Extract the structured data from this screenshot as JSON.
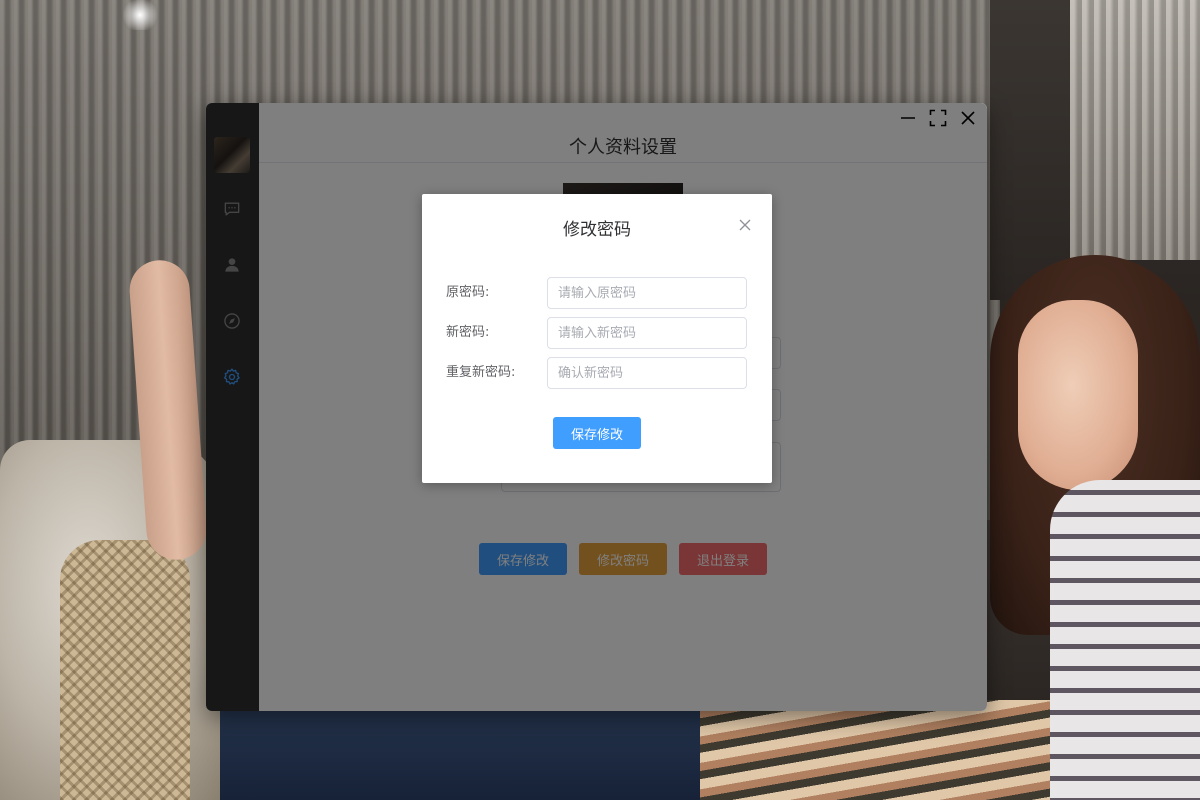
{
  "app": {
    "page_title": "个人资料设置"
  },
  "sidebar": {
    "items": [
      {
        "icon": "chat-icon",
        "active": false
      },
      {
        "icon": "user-icon",
        "active": false
      },
      {
        "icon": "compass-icon",
        "active": false
      },
      {
        "icon": "gear-icon",
        "active": true
      }
    ]
  },
  "profile_form": {
    "buttons": {
      "save": "保存修改",
      "change_password": "修改密码",
      "logout": "退出登录"
    }
  },
  "dialog": {
    "title": "修改密码",
    "fields": {
      "old_password": {
        "label": "原密码:",
        "placeholder": "请输入原密码",
        "value": ""
      },
      "new_password": {
        "label": "新密码:",
        "placeholder": "请输入新密码",
        "value": ""
      },
      "confirm_password": {
        "label": "重复新密码:",
        "placeholder": "确认新密码",
        "value": ""
      }
    },
    "save_label": "保存修改"
  },
  "colors": {
    "primary": "#409eff",
    "warning": "#e6a23c",
    "danger": "#f56c6c",
    "sidebar_bg": "#2e2e2e",
    "active_icon": "#409eff"
  }
}
